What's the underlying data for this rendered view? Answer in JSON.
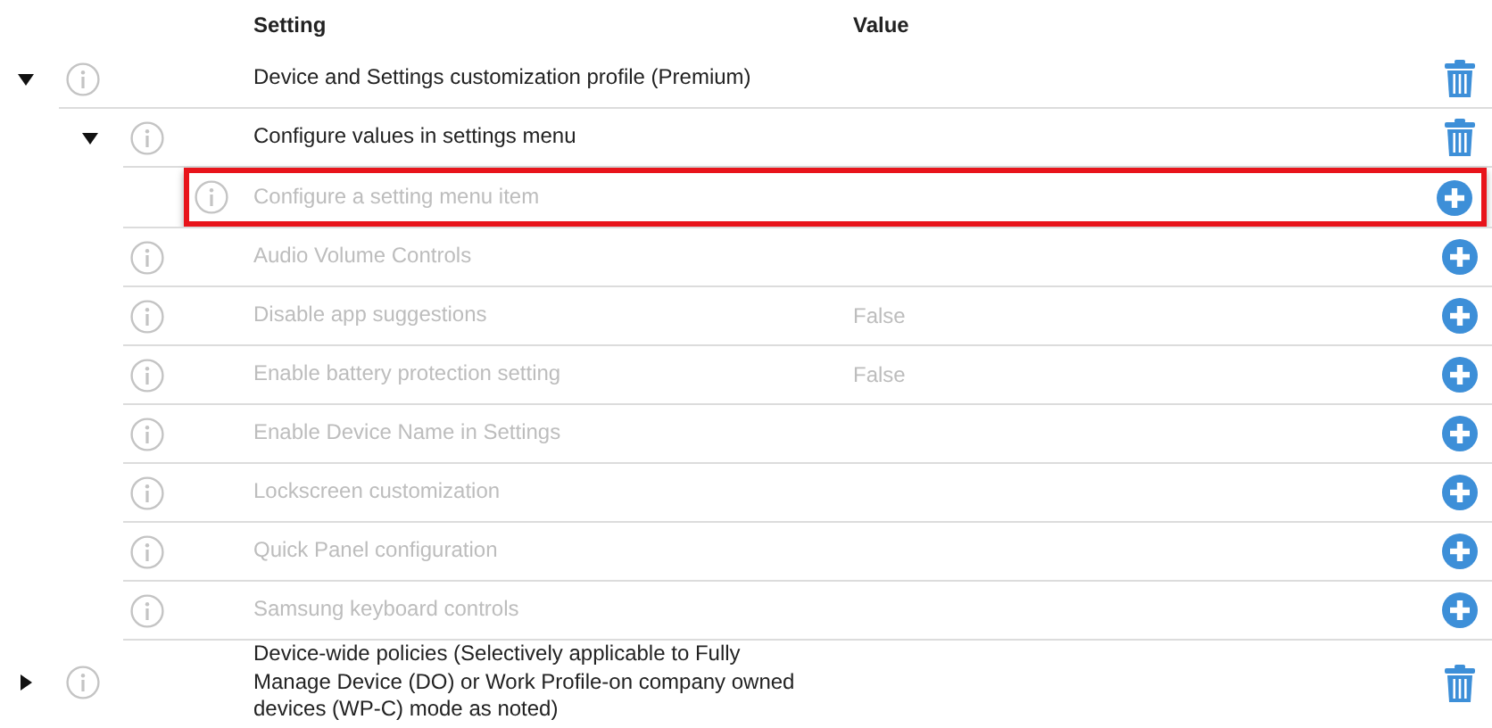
{
  "columns": [
    "Setting",
    "Value"
  ],
  "rows": [
    {
      "kind": "group",
      "label": "Device and Settings customization profile (Premium)",
      "expanded": true,
      "disabled": false,
      "selected": false,
      "deletable": true,
      "children": [
        {
          "kind": "group",
          "label": "Configure values in settings menu",
          "expanded": true,
          "disabled": false,
          "selected": false,
          "deletable": true,
          "children": [
            {
              "kind": "new",
              "label": "Configure a setting menu item",
              "disabled": true,
              "selected": true,
              "deletable": false
            },
            {
              "kind": "item",
              "label": "Audio Volume Controls",
              "disabled": true,
              "selected": false,
              "deletable": false
            },
            {
              "kind": "item",
              "label": "Disable app suggestions",
              "value": "False",
              "disabled": true,
              "selected": false,
              "deletable": false
            },
            {
              "kind": "item",
              "label": "Enable battery protection setting",
              "value": "False",
              "disabled": true,
              "selected": false,
              "deletable": false
            },
            {
              "kind": "item",
              "label": "Enable Device Name in Settings",
              "disabled": true,
              "selected": false,
              "deletable": false
            },
            {
              "kind": "item",
              "label": "Lockscreen customization",
              "disabled": true,
              "selected": false,
              "deletable": false
            },
            {
              "kind": "item",
              "label": "Quick Panel configuration",
              "disabled": true,
              "selected": false,
              "deletable": false
            },
            {
              "kind": "item",
              "label": "Samsung keyboard controls",
              "disabled": true,
              "selected": false,
              "deletable": false
            }
          ]
        }
      ]
    },
    {
      "kind": "group",
      "label": "Device-wide policies (Selectively applicable to Fully Manage Device (DO) or Work Profile-on company owned devices (WP-C) mode as noted)",
      "expanded": false,
      "disabled": false,
      "selected": false,
      "deletable": true
    }
  ]
}
